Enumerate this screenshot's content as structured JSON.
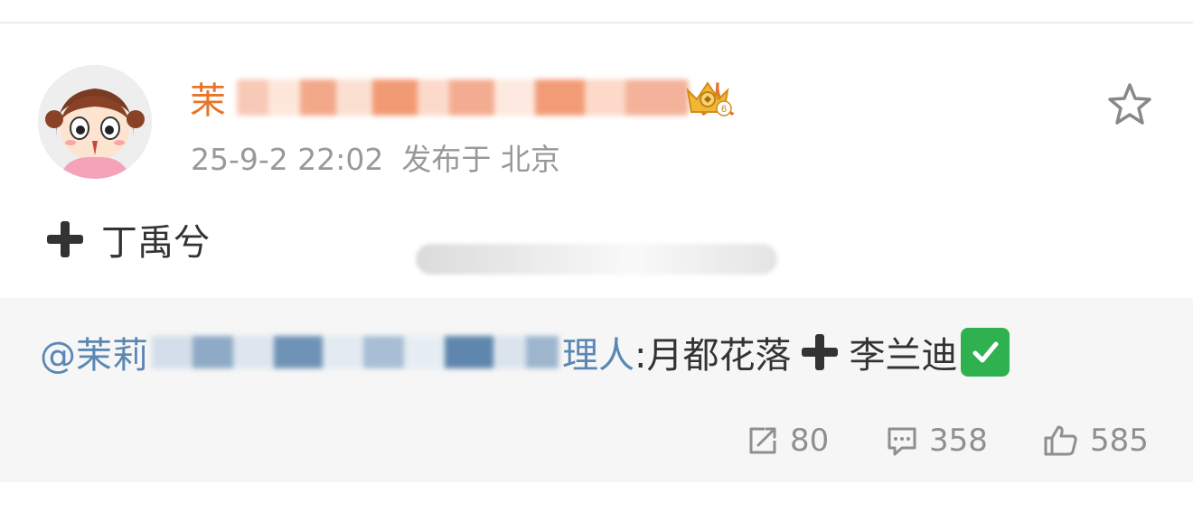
{
  "post": {
    "author": {
      "name_prefix": "茉",
      "name_suffix": "人",
      "vip_level": "6"
    },
    "meta": {
      "date": "25-9-2 22:02",
      "published_from": "发布于 北京"
    },
    "text": "丁禹兮",
    "repost": {
      "mention_prefix": "@茉莉",
      "mention_suffix": "理人",
      "content": ":月都花落",
      "content_after": "李兰迪"
    },
    "stats": {
      "shares": "80",
      "comments": "358",
      "likes": "585"
    }
  },
  "colors": {
    "username": "#e8742b",
    "mention": "#5b87b4",
    "meta": "#999999",
    "repost_bg": "#f6f6f6"
  },
  "icons": [
    "star-icon",
    "plus-icon",
    "share-icon",
    "comment-icon",
    "like-icon",
    "check-icon",
    "crown-badge-icon"
  ]
}
